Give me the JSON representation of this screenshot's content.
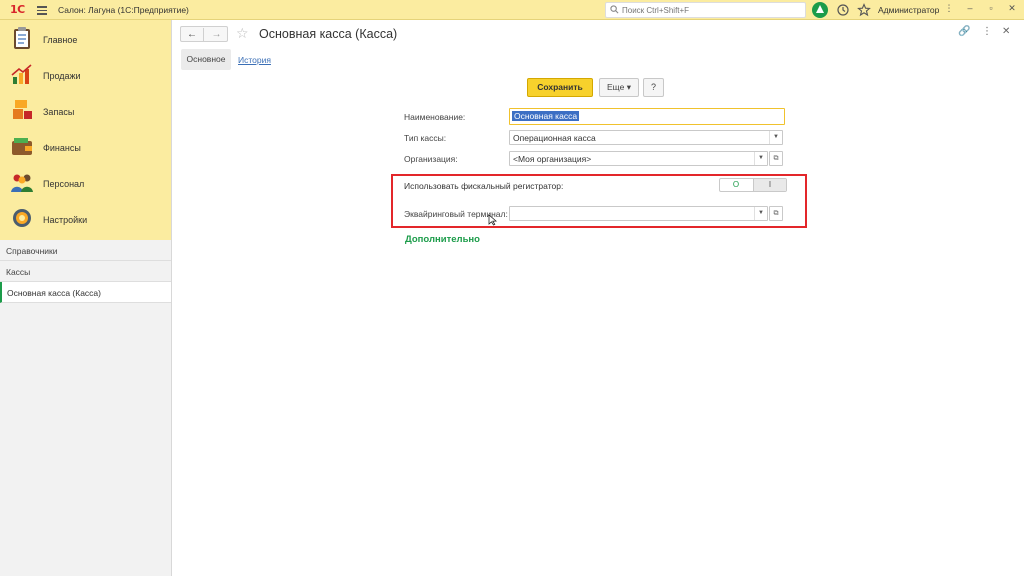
{
  "topbar": {
    "logo": "1С",
    "title": "Салон: Лагуна  (1С:Предприятие)",
    "search_placeholder": "Поиск Ctrl+Shift+F",
    "user": "Администратор",
    "accent": "#fbeca0"
  },
  "sidebar": {
    "sections": [
      {
        "label": "Главное",
        "icon": "clipboard-icon"
      },
      {
        "label": "Продажи",
        "icon": "chart-growth-icon"
      },
      {
        "label": "Запасы",
        "icon": "boxes-icon"
      },
      {
        "label": "Финансы",
        "icon": "wallet-icon"
      },
      {
        "label": "Персонал",
        "icon": "people-icon"
      },
      {
        "label": "Настройки",
        "icon": "gear-icon"
      }
    ],
    "nav": [
      {
        "label": "Справочники"
      },
      {
        "label": "Кассы"
      },
      {
        "label": "Основная касса (Касса)"
      }
    ]
  },
  "form": {
    "title": "Основная касса (Касса)",
    "tab_main": "Основное",
    "tab_history": "История",
    "save_label": "Сохранить",
    "more_label": "Еще",
    "help_label": "?",
    "fields": {
      "name_label": "Наименование:",
      "name_value": "Основная касса",
      "type_label": "Тип кассы:",
      "type_value": "Операционная касса",
      "org_label": "Организация:",
      "org_value": "<Моя организация>",
      "fiscal_label": "Использовать фискальный регистратор:",
      "fiscal_on": "O",
      "fiscal_off": "I",
      "terminal_label": "Эквайринговый терминал:",
      "terminal_value": ""
    },
    "more_link": "Дополнительно",
    "highlight_color": "#e3262a",
    "save_color": "#f7d12c",
    "green_accent": "#1c9c4a"
  }
}
